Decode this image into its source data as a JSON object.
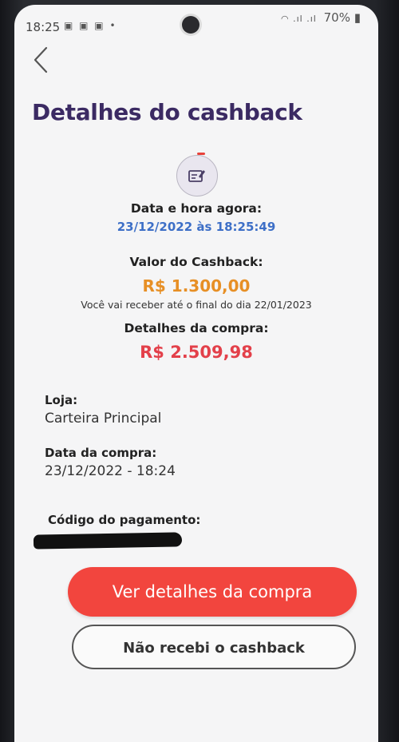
{
  "status_bar": {
    "time": "18:25",
    "notification_icons": "▣ ▣ ▣ •",
    "battery": "70%"
  },
  "header": {
    "back_icon": "chevron-left-icon",
    "title": "Detalhes do cashback"
  },
  "summary": {
    "icon": "receipt-hand-icon",
    "datetime_label": "Data e hora agora:",
    "datetime_value": "23/12/2022 às 18:25:49",
    "cashback_label": "Valor do Cashback:",
    "cashback_value": "R$ 1.300,00",
    "cashback_note": "Você vai receber até o final do dia 22/01/2023",
    "purchase_label": "Detalhes da compra:",
    "purchase_value": "R$ 2.509,98"
  },
  "details": {
    "store_label": "Loja:",
    "store_value": "Carteira Principal",
    "purchase_date_label": "Data da compra:",
    "purchase_date_value": "23/12/2022 - 18:24",
    "payment_code_label": "Código do pagamento:"
  },
  "actions": {
    "primary_label": "Ver detalhes da compra",
    "secondary_label": "Não recebi o cashback"
  },
  "colors": {
    "title": "#3b2a63",
    "datetime": "#3d6fc7",
    "cashback": "#e78f25",
    "purchase": "#e3404a",
    "primary_button": "#f2453e"
  }
}
